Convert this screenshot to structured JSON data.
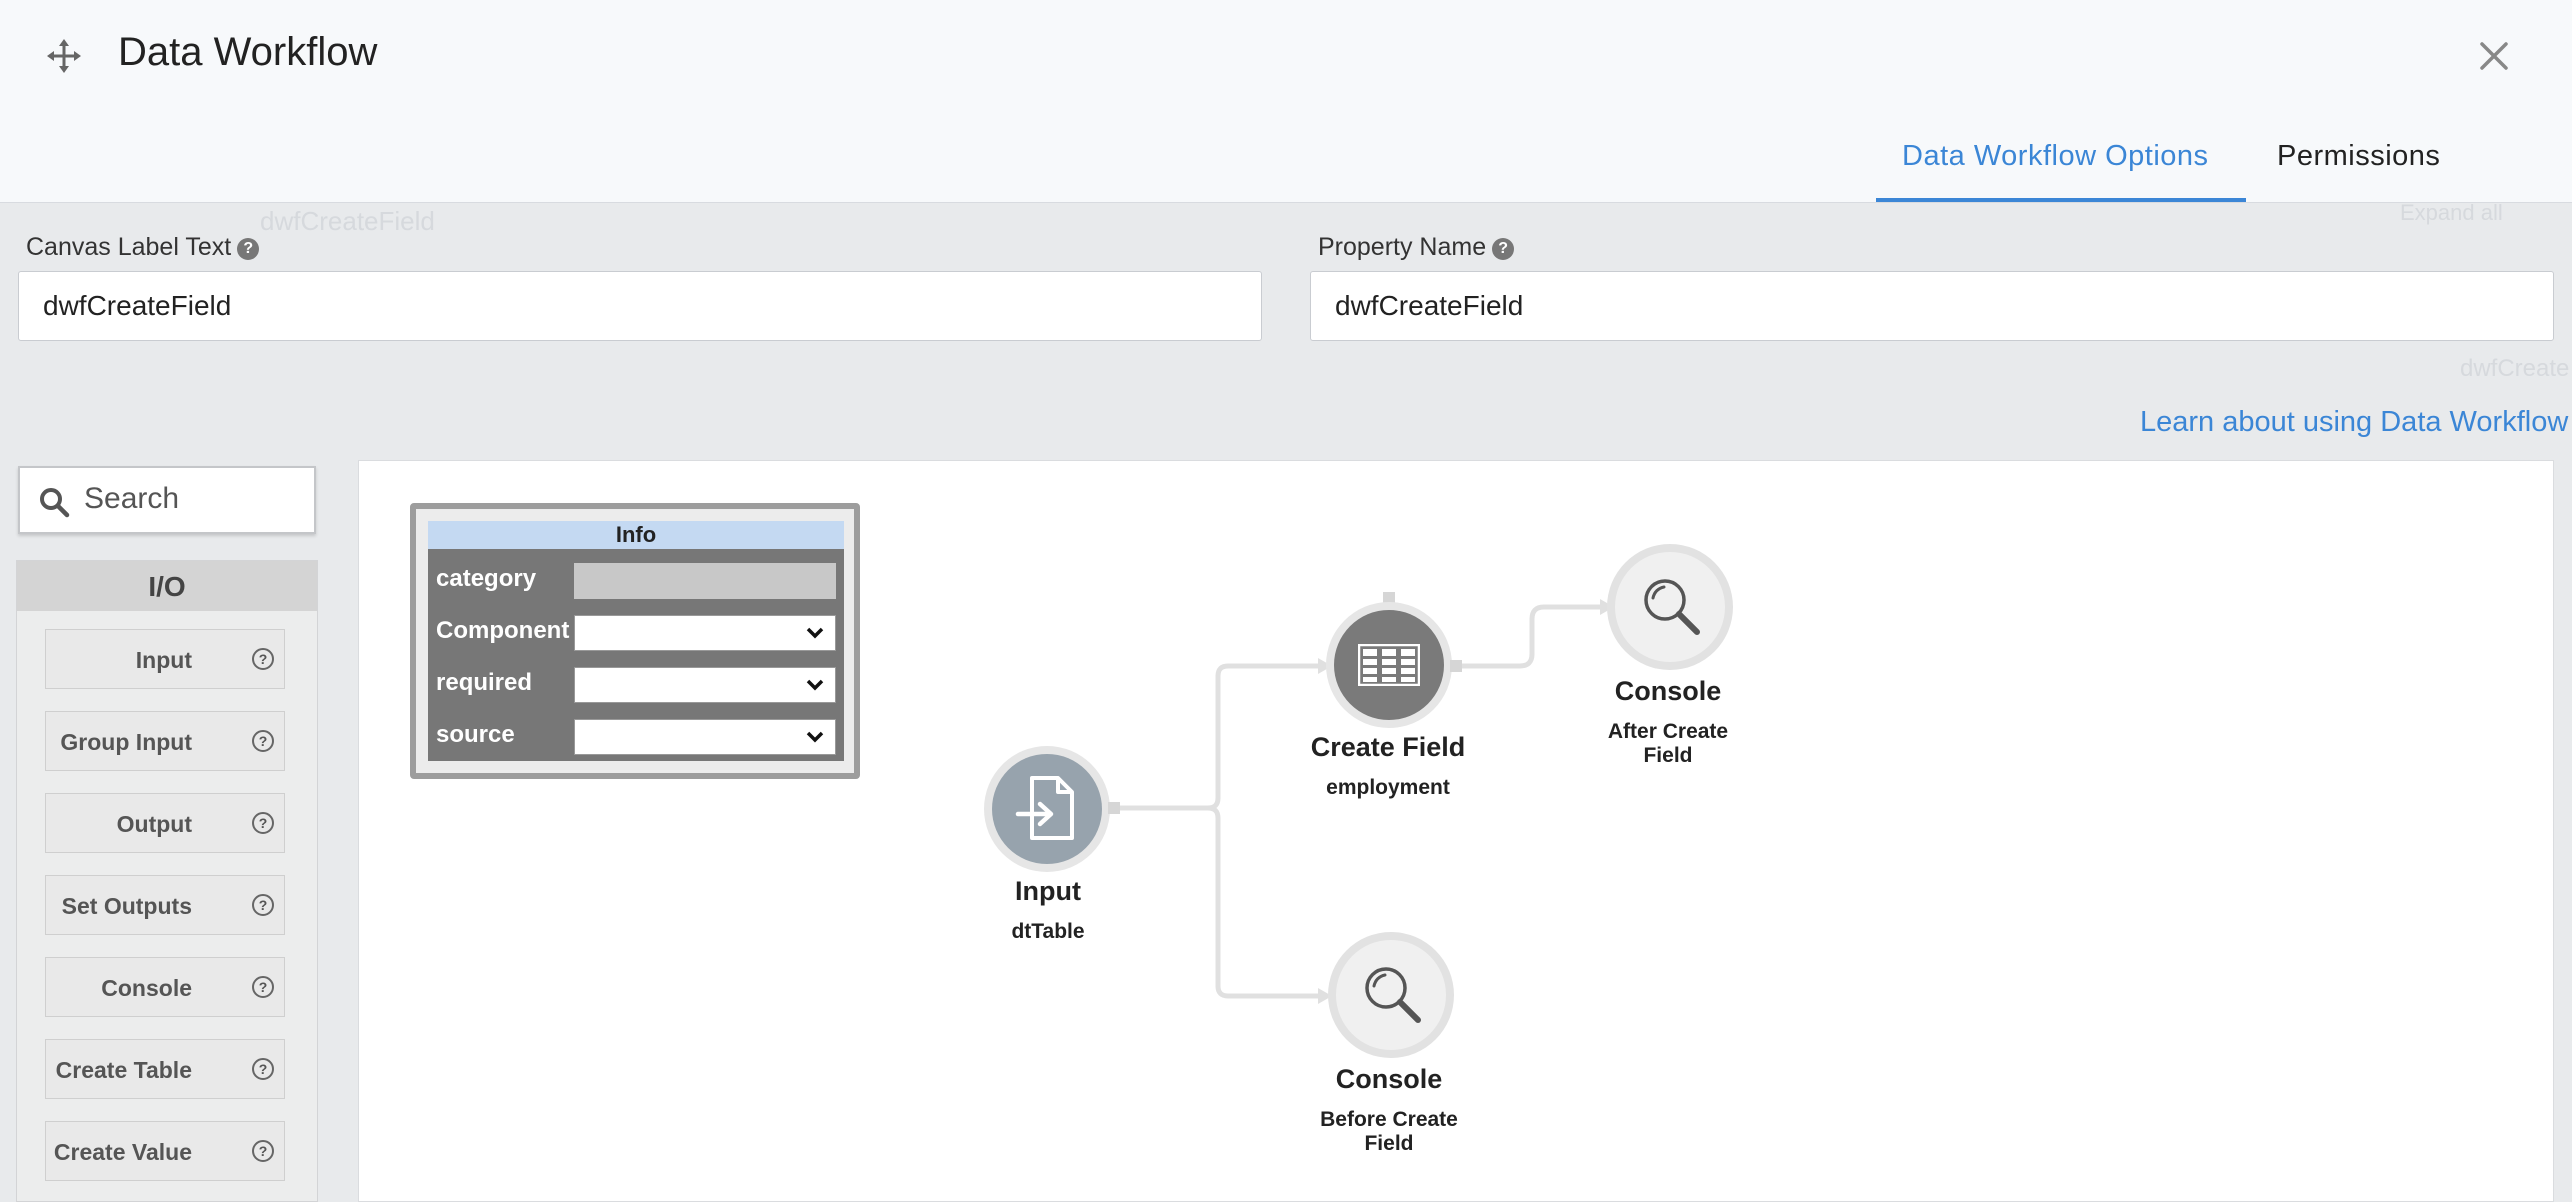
{
  "header": {
    "title": "Data Workflow",
    "tabs": [
      {
        "label": "Data Workflow Options",
        "active": true
      },
      {
        "label": "Permissions",
        "active": false
      }
    ]
  },
  "background": {
    "ghost_title": "dwfCreateField",
    "ghost_expand": "Expand all",
    "ghost_right": "dwfCreate"
  },
  "fields": {
    "canvas_label": {
      "label": "Canvas Label Text",
      "value": "dwfCreateField"
    },
    "property_name": {
      "label": "Property Name",
      "value": "dwfCreateField"
    }
  },
  "learn_link": "Learn about using Data Workflow",
  "search": {
    "placeholder": "Search"
  },
  "palette": {
    "heading": "I/O",
    "items": [
      "Input",
      "Group Input",
      "Output",
      "Set Outputs",
      "Console",
      "Create Table",
      "Create Value"
    ]
  },
  "info_panel": {
    "title": "Info",
    "rows": [
      {
        "label": "category",
        "type": "disabled",
        "value": ""
      },
      {
        "label": "Component",
        "type": "select",
        "value": ""
      },
      {
        "label": "required",
        "type": "select",
        "value": ""
      },
      {
        "label": "source",
        "type": "select",
        "value": ""
      }
    ]
  },
  "nodes": {
    "input": {
      "title": "Input",
      "subtitle": "dtTable",
      "icon": "file-import-icon"
    },
    "create_field": {
      "title": "Create Field",
      "subtitle": "employment",
      "icon": "table-icon"
    },
    "console_after": {
      "title": "Console",
      "subtitle_line1": "After Create",
      "subtitle_line2": "Field",
      "icon": "magnifier-icon"
    },
    "console_before": {
      "title": "Console",
      "subtitle_line1": "Before Create",
      "subtitle_line2": "Field",
      "icon": "magnifier-icon"
    }
  },
  "colors": {
    "accent": "#3b86d6",
    "node_dark": "#7a7a7a",
    "node_input": "#97a3ad",
    "node_light": "#efefef"
  }
}
